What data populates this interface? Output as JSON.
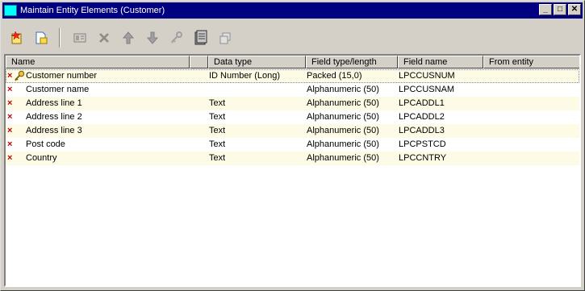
{
  "window": {
    "title": "Maintain Entity Elements (Customer)",
    "controls": {
      "minimize": "_",
      "maximize": "□",
      "close": "✕"
    }
  },
  "toolbar": {
    "buttons": [
      {
        "name": "new-element-icon",
        "enabled": true
      },
      {
        "name": "add-from-file-icon",
        "enabled": true
      },
      {
        "name": "properties-icon",
        "enabled": false
      },
      {
        "name": "delete-icon",
        "enabled": false
      },
      {
        "name": "move-up-icon",
        "enabled": false
      },
      {
        "name": "move-down-icon",
        "enabled": false
      },
      {
        "name": "key-icon",
        "enabled": false
      },
      {
        "name": "notes-icon",
        "enabled": true
      },
      {
        "name": "copy-icon",
        "enabled": false
      }
    ]
  },
  "columns": [
    "Name",
    "",
    "Data type",
    "Field type/length",
    "Field name",
    "From entity"
  ],
  "rows": [
    {
      "name": "Customer number",
      "data_type": "ID Number (Long)",
      "field_type": "Packed (15,0)",
      "field_name": "LPCCUSNUM",
      "from_entity": "",
      "key": true
    },
    {
      "name": "Customer name",
      "data_type": "",
      "field_type": "Alphanumeric (50)",
      "field_name": "LPCCUSNAM",
      "from_entity": "",
      "key": false
    },
    {
      "name": "Address line 1",
      "data_type": "Text",
      "field_type": "Alphanumeric (50)",
      "field_name": "LPCADDL1",
      "from_entity": "",
      "key": false
    },
    {
      "name": "Address line 2",
      "data_type": "Text",
      "field_type": "Alphanumeric (50)",
      "field_name": "LPCADDL2",
      "from_entity": "",
      "key": false
    },
    {
      "name": "Address line 3",
      "data_type": "Text",
      "field_type": "Alphanumeric (50)",
      "field_name": "LPCADDL3",
      "from_entity": "",
      "key": false
    },
    {
      "name": "Post code",
      "data_type": "Text",
      "field_type": "Alphanumeric (50)",
      "field_name": "LPCPSTCD",
      "from_entity": "",
      "key": false
    },
    {
      "name": "Country",
      "data_type": "Text",
      "field_type": "Alphanumeric (50)",
      "field_name": "LPCCNTRY",
      "from_entity": "",
      "key": false
    }
  ],
  "row_marker": "×",
  "colors": {
    "titlebar": "#000080",
    "row_tint": "#fdfbe5",
    "marker": "#c00000"
  }
}
